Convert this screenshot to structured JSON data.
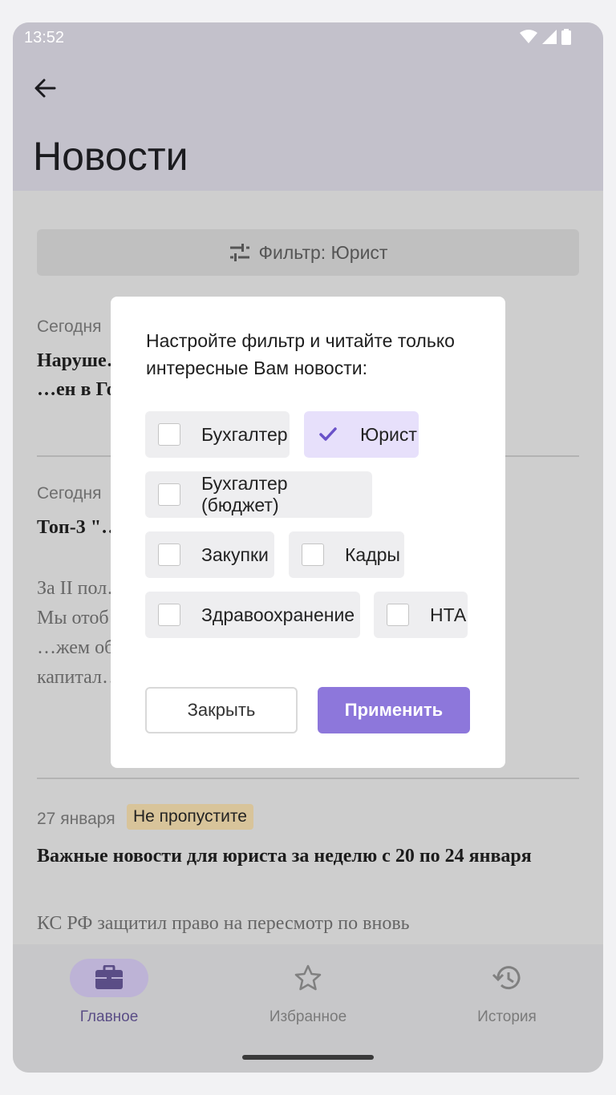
{
  "status": {
    "time": "13:52"
  },
  "header": {
    "title": "Новости"
  },
  "filter": {
    "label": "Фильтр: Юрист"
  },
  "news": [
    {
      "date": "Сегодня",
      "title": "Наруше… …ции: проект … …ен в Госдуму"
    },
    {
      "date": "Сегодня",
      "title": "Топ-3 \"… …I полугод…",
      "body": "За II пол… появило… …огам. Мы отоб… …вный суд не со… …жем об уменьше… …шенных капитал…"
    },
    {
      "date": "27 января",
      "badge": "Не пропустите",
      "title": "Важные новости для юриста за неделю с 20 по 24 января",
      "body": "КС РФ защитил право на пересмотр по вновь"
    }
  ],
  "dialog": {
    "text": "Настройте фильтр и читайте только интересные Вам новости:",
    "options": [
      {
        "label": "Бухгалтер",
        "checked": false
      },
      {
        "label": "Юрист",
        "checked": true
      },
      {
        "label": "Бухгалтер (бюджет)",
        "checked": false
      },
      {
        "label": "Закупки",
        "checked": false
      },
      {
        "label": "Кадры",
        "checked": false
      },
      {
        "label": "Здравоохранение",
        "checked": false
      },
      {
        "label": "НТА",
        "checked": false
      }
    ],
    "close_label": "Закрыть",
    "apply_label": "Применить"
  },
  "nav": {
    "items": [
      {
        "label": "Главное",
        "icon": "briefcase-icon",
        "active": true
      },
      {
        "label": "Избранное",
        "icon": "star-icon",
        "active": false
      },
      {
        "label": "История",
        "icon": "history-icon",
        "active": false
      }
    ]
  },
  "colors": {
    "accent": "#8d77db",
    "active_nav": "#5a4d86"
  }
}
